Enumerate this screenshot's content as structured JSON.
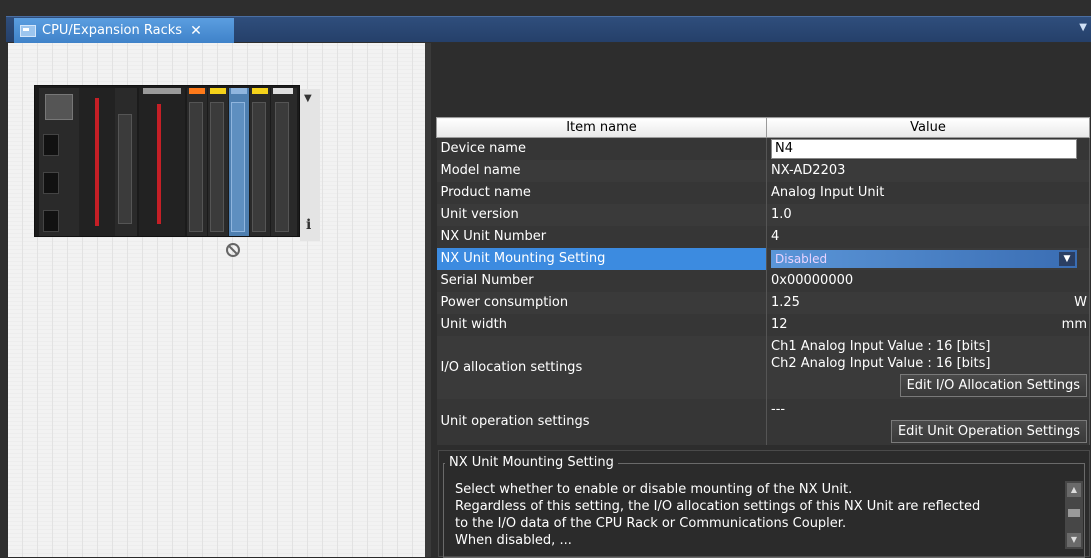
{
  "tab": {
    "label": "CPU/Expansion Racks",
    "close": "✕",
    "menu": "▼"
  },
  "rack": {
    "info_label": "i",
    "scroll_arrow": "▼"
  },
  "table": {
    "header_name": "Item name",
    "header_value": "Value",
    "device_name": {
      "label": "Device name",
      "value": "N4"
    },
    "model_name": {
      "label": "Model name",
      "value": "NX-AD2203"
    },
    "product_name": {
      "label": "Product name",
      "value": "Analog Input Unit"
    },
    "unit_version": {
      "label": "Unit version",
      "value": "1.0"
    },
    "nx_unit_number": {
      "label": "NX Unit Number",
      "value": "4"
    },
    "mounting_setting": {
      "label": "NX Unit Mounting Setting",
      "value": "Disabled",
      "arrow": "▼"
    },
    "serial_number": {
      "label": "Serial Number",
      "value": "0x00000000"
    },
    "power": {
      "label": "Power consumption",
      "value": "1.25",
      "unit": "W"
    },
    "unit_width": {
      "label": "Unit width",
      "value": "12",
      "unit": "mm"
    },
    "io_allocation": {
      "label": "I/O allocation settings",
      "line1": "Ch1 Analog Input Value : 16 [bits]",
      "line2": "Ch2 Analog Input Value : 16 [bits]",
      "button": "Edit I/O Allocation Settings"
    },
    "unit_operation": {
      "label": "Unit operation settings",
      "value": "---",
      "button": "Edit Unit Operation Settings"
    }
  },
  "help": {
    "title": "NX Unit Mounting Setting",
    "line1": "Select whether to enable or disable mounting of the NX Unit.",
    "line2": "Regardless of this setting, the I/O allocation settings of this NX Unit are reflected",
    "line3": "to the I/O data of the CPU Rack or Communications Coupler.",
    "line4": "When disabled, ...",
    "scroll_up": "▲",
    "scroll_down": "▼"
  },
  "colors": {
    "selected_row": "#3c8be0",
    "dropdown_text": "#e9d3ff",
    "tab_active": "#4a8fd6"
  }
}
